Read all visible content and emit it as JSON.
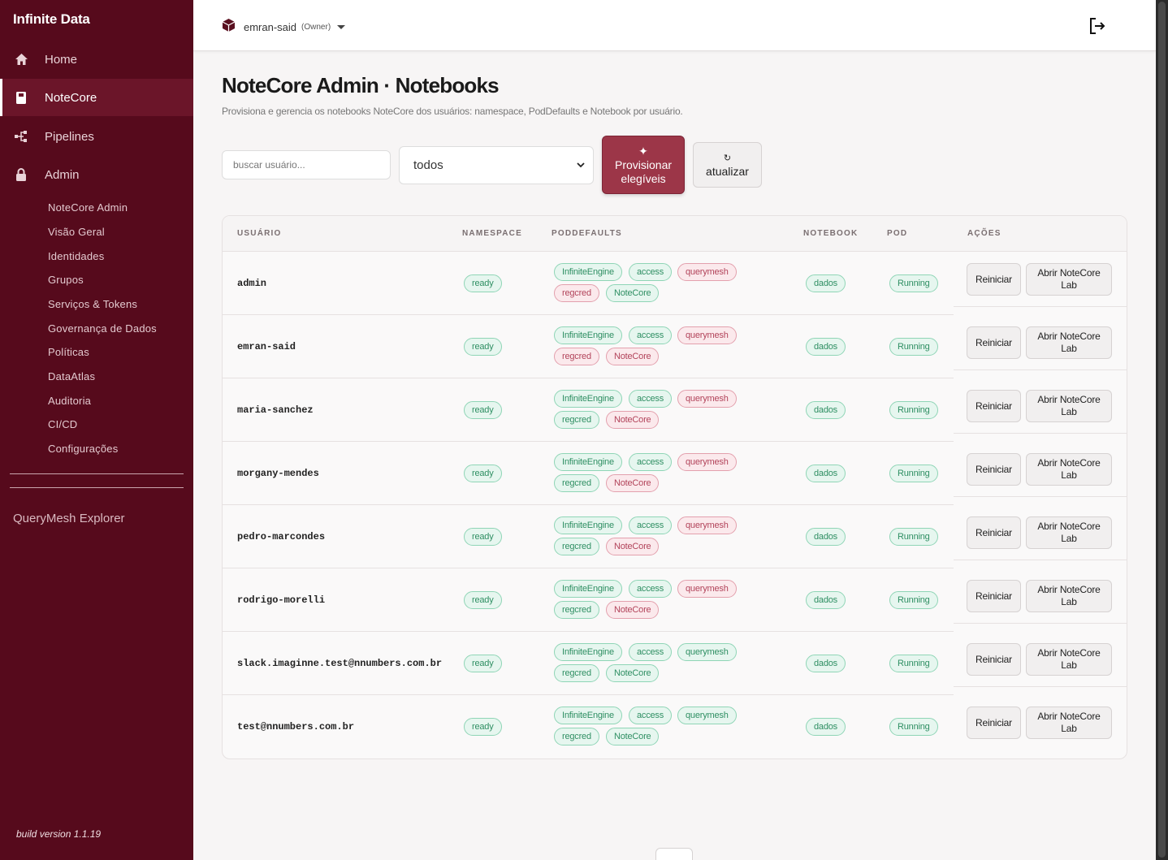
{
  "sidebar": {
    "brand": "Infinite Data",
    "nav": [
      {
        "label": "Home",
        "icon": "home-icon"
      },
      {
        "label": "NoteCore",
        "icon": "notebook-icon",
        "active": true
      },
      {
        "label": "Pipelines",
        "icon": "pipeline-icon"
      },
      {
        "label": "Admin",
        "icon": "lock-icon"
      }
    ],
    "admin_items": [
      "NoteCore Admin",
      "Visão Geral",
      "Identidades",
      "Grupos",
      "Serviços & Tokens",
      "Governança de Dados",
      "Políticas",
      "DataAtlas",
      "Auditoria",
      "CI/CD",
      "Configurações"
    ],
    "querymesh": "QueryMesh Explorer",
    "build": "build version 1.1.19"
  },
  "topbar": {
    "user": "emran-said",
    "role": "(Owner)"
  },
  "page": {
    "title": "NoteCore Admin · Notebooks",
    "subtitle": "Provisiona e gerencia os notebooks NoteCore dos usuários: namespace, PodDefaults e Notebook por usuário."
  },
  "controls": {
    "search_placeholder": "buscar usuário...",
    "filter_value": "todos",
    "provision_icon": "✦",
    "provision_label_1": "Provisionar",
    "provision_label_2": "elegíveis",
    "refresh_icon": "↻",
    "refresh_label": "atualizar"
  },
  "table": {
    "headers": {
      "user": "USUÁRIO",
      "namespace": "NAMESPACE",
      "poddefaults": "PODDEFAULTS",
      "notebook": "NOTEBOOK",
      "pod": "POD",
      "actions": "AÇÕES"
    },
    "restart_label": "Reiniciar",
    "open_label_1": "Abrir NoteCore",
    "open_label_2": "Lab",
    "rows": [
      {
        "user": "admin",
        "namespace": "ready",
        "pd": [
          [
            "InfiniteEngine",
            "g"
          ],
          [
            "access",
            "g"
          ],
          [
            "querymesh",
            "r"
          ],
          [
            "regcred",
            "r"
          ],
          [
            "NoteCore",
            "g"
          ]
        ],
        "notebook": "dados",
        "pod": "Running"
      },
      {
        "user": "emran-said",
        "namespace": "ready",
        "pd": [
          [
            "InfiniteEngine",
            "g"
          ],
          [
            "access",
            "g"
          ],
          [
            "querymesh",
            "r"
          ],
          [
            "regcred",
            "r"
          ],
          [
            "NoteCore",
            "r"
          ]
        ],
        "notebook": "dados",
        "pod": "Running"
      },
      {
        "user": "maria-sanchez",
        "namespace": "ready",
        "pd": [
          [
            "InfiniteEngine",
            "g"
          ],
          [
            "access",
            "g"
          ],
          [
            "querymesh",
            "r"
          ],
          [
            "regcred",
            "g"
          ],
          [
            "NoteCore",
            "r"
          ]
        ],
        "notebook": "dados",
        "pod": "Running"
      },
      {
        "user": "morgany-mendes",
        "namespace": "ready",
        "pd": [
          [
            "InfiniteEngine",
            "g"
          ],
          [
            "access",
            "g"
          ],
          [
            "querymesh",
            "r"
          ],
          [
            "regcred",
            "g"
          ],
          [
            "NoteCore",
            "r"
          ]
        ],
        "notebook": "dados",
        "pod": "Running"
      },
      {
        "user": "pedro-marcondes",
        "namespace": "ready",
        "pd": [
          [
            "InfiniteEngine",
            "g"
          ],
          [
            "access",
            "g"
          ],
          [
            "querymesh",
            "r"
          ],
          [
            "regcred",
            "g"
          ],
          [
            "NoteCore",
            "r"
          ]
        ],
        "notebook": "dados",
        "pod": "Running"
      },
      {
        "user": "rodrigo-morelli",
        "namespace": "ready",
        "pd": [
          [
            "InfiniteEngine",
            "g"
          ],
          [
            "access",
            "g"
          ],
          [
            "querymesh",
            "r"
          ],
          [
            "regcred",
            "g"
          ],
          [
            "NoteCore",
            "r"
          ]
        ],
        "notebook": "dados",
        "pod": "Running"
      },
      {
        "user": "slack.imaginne.test@nnumbers.com.br",
        "namespace": "ready",
        "pd": [
          [
            "InfiniteEngine",
            "g"
          ],
          [
            "access",
            "g"
          ],
          [
            "querymesh",
            "g"
          ],
          [
            "regcred",
            "g"
          ],
          [
            "NoteCore",
            "g"
          ]
        ],
        "notebook": "dados",
        "pod": "Running"
      },
      {
        "user": "test@nnumbers.com.br",
        "namespace": "ready",
        "pd": [
          [
            "InfiniteEngine",
            "g"
          ],
          [
            "access",
            "g"
          ],
          [
            "querymesh",
            "g"
          ],
          [
            "regcred",
            "g"
          ],
          [
            "NoteCore",
            "g"
          ]
        ],
        "notebook": "dados",
        "pod": "Running"
      }
    ]
  },
  "colors": {
    "sidebar": "#560a1c",
    "accent": "#9c3648",
    "ok": "#2f8f63",
    "bad": "#b2435a"
  }
}
